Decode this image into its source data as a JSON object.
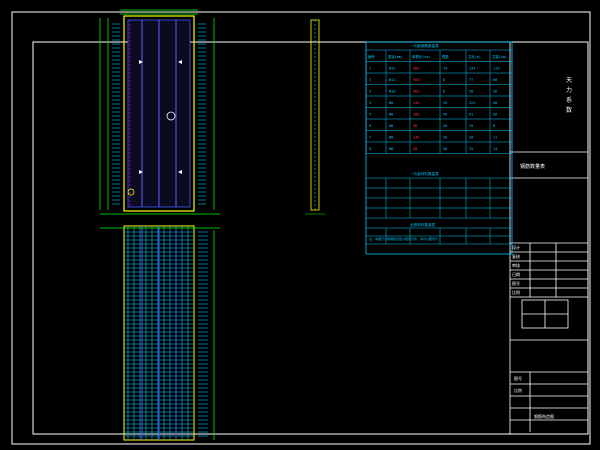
{
  "title_block": {
    "vertical_title": [
      "天",
      "力",
      "系",
      "数"
    ],
    "drawing_name": "钢筋数量表",
    "scale_label": "比例",
    "sheet_label": "图号",
    "rows": [
      "设计",
      "复核",
      "审核",
      "日期",
      "图号",
      "比例"
    ],
    "footer_label": "钢筋构造图"
  },
  "table": {
    "top_title": "一片板钢筋数量表",
    "mid_title": "一片板材料数量表",
    "low_title": "全桥材料数量表",
    "headers": [
      "编号",
      "直径(mm)",
      "单根长(cm)",
      "根数",
      "共长(m)",
      "共重(kg)"
    ],
    "rows": [
      {
        "id": "1",
        "dia": "Φ12",
        "len": "960",
        "n": "14",
        "total": "134",
        "wt": "119"
      },
      {
        "id": "2",
        "dia": "Φ12",
        "len": "960",
        "n": "8",
        "total": "77",
        "wt": "68"
      },
      {
        "id": "3",
        "dia": "Φ10",
        "len": "960",
        "n": "6",
        "total": "58",
        "wt": "36"
      },
      {
        "id": "4",
        "dia": "Φ8",
        "len": "248",
        "n": "49",
        "total": "122",
        "wt": "48"
      },
      {
        "id": "5",
        "dia": "Φ8",
        "len": "186",
        "n": "49",
        "total": "91",
        "wt": "36"
      },
      {
        "id": "6",
        "dia": "Φ8",
        "len": "96",
        "n": "20",
        "total": "19",
        "wt": "8"
      },
      {
        "id": "7",
        "dia": "Φ8",
        "len": "140",
        "n": "20",
        "total": "28",
        "wt": "11"
      },
      {
        "id": "8",
        "dia": "Φ8",
        "len": "88",
        "n": "40",
        "total": "35",
        "wt": "14"
      }
    ],
    "note": "注：本图尺寸除钢筋直径以毫米计外，余均以厘米计。"
  },
  "colors": {
    "background": "#000000",
    "frame": "#ffffff",
    "yellow": "#ffff00",
    "cyan": "#00c8ff",
    "green": "#00ff00",
    "blue": "#3c5aff",
    "magenta": "#ff00ff",
    "red": "#ff3030"
  }
}
